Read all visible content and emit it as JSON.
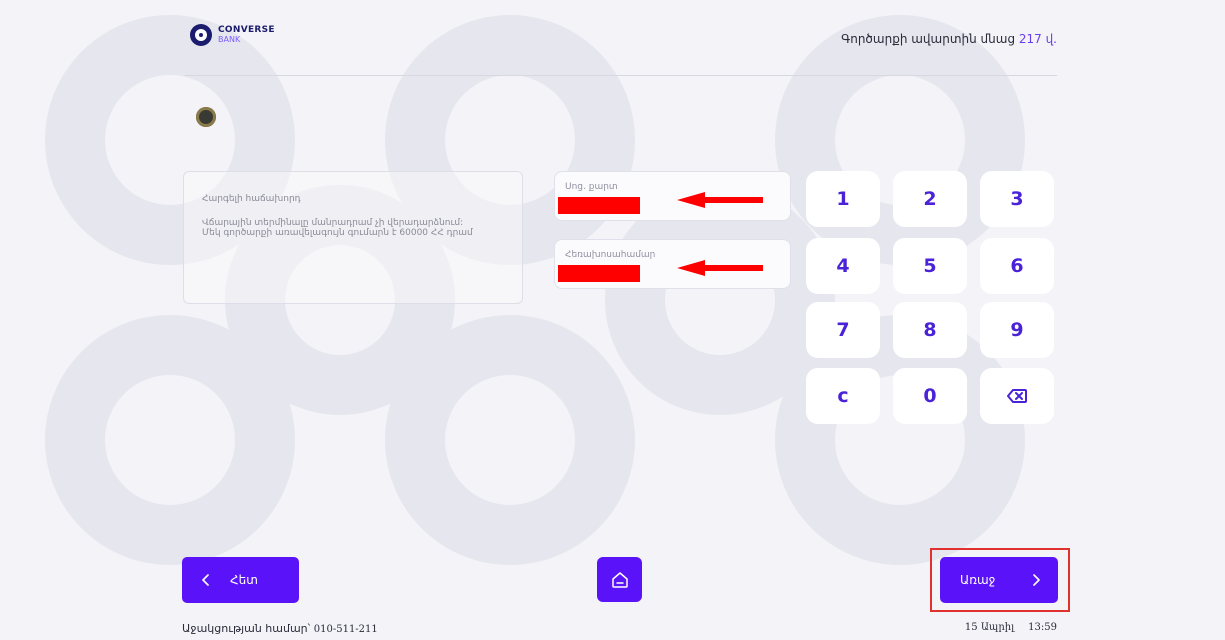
{
  "header": {
    "logo_line1": "CONVERSE",
    "logo_line2": "BANK",
    "timer_prefix": "Գործարքի ավարտին մնաց ",
    "timer_seconds": "217",
    "timer_suffix": " վ."
  },
  "info": {
    "title": "Հարգելի հաճախորդ",
    "line1": "Վճարային տերմինալը մանրադրամ չի վերադարձնում:",
    "line2": "Մեկ գործարքի առավելագույն գումարն է 60000 ՀՀ դրամ"
  },
  "fields": {
    "card_label": "Սոց. քարտ",
    "phone_label": "Հեռախոսահամար"
  },
  "keypad": {
    "k1": "1",
    "k2": "2",
    "k3": "3",
    "k4": "4",
    "k5": "5",
    "k6": "6",
    "k7": "7",
    "k8": "8",
    "k9": "9",
    "kc": "c",
    "k0": "0",
    "kdel": "⌫"
  },
  "nav": {
    "back_label": "Հետ",
    "next_label": "Առաջ"
  },
  "footer": {
    "support_label": "Աջակցության համար՝",
    "support_phone": "010-511-211",
    "date": "15 Ապրիլ",
    "time": "13:59"
  },
  "colors": {
    "accent": "#5a13f8",
    "key_text": "#4a22d8",
    "redaction": "#ff0000",
    "highlight_border": "#e03030"
  },
  "icons": {
    "back": "chevron-left-icon",
    "next": "chevron-right-icon",
    "home": "home-icon",
    "delete": "backspace-icon"
  }
}
